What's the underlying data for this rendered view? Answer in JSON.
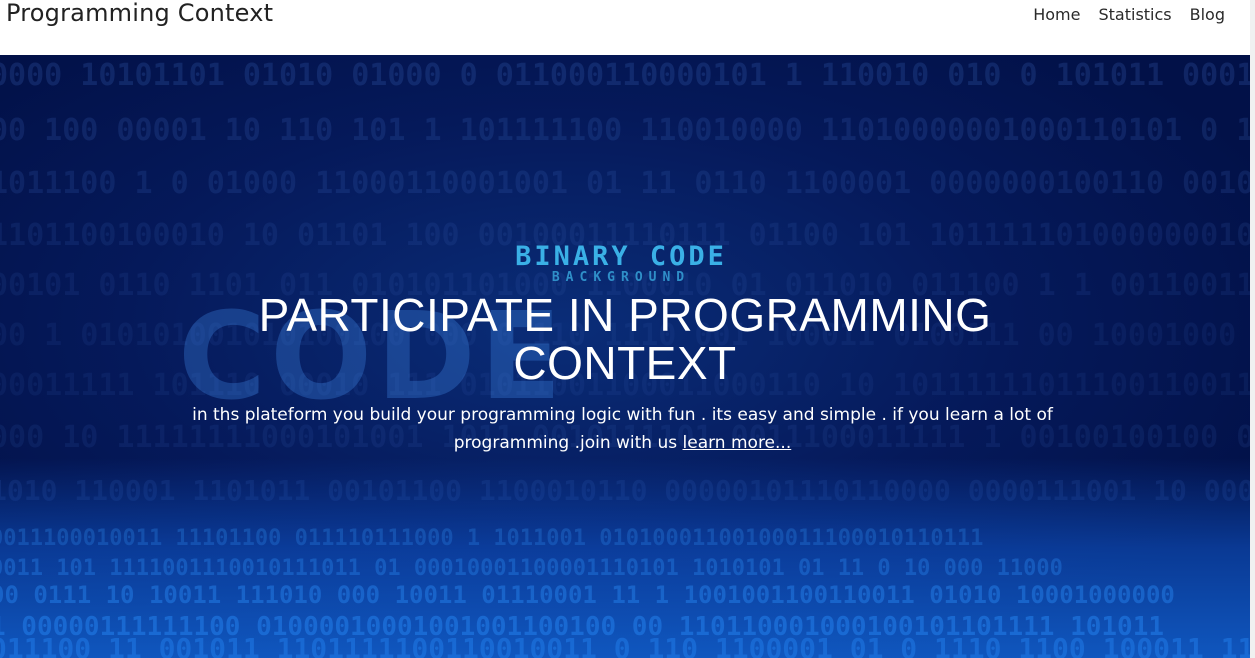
{
  "navbar": {
    "brand": "Programming Context",
    "links": [
      "Home",
      "Statistics",
      "Blog"
    ]
  },
  "hero": {
    "logo_main": "BINARY CODE",
    "logo_sub": "BACKGROUND",
    "background_word": "CODE",
    "title_line1": "PARTICIPATE IN PROGRAMMING",
    "title_line2": "CONTEXT",
    "description": "in ths plateform you build your programming logic with fun . its easy and simple . if you learn a lot of programming .join with us",
    "learn_more": "learn more..."
  },
  "colors": {
    "hero_bg": "#05195a",
    "accent": "#3ab0e6",
    "text": "#ffffff"
  }
}
